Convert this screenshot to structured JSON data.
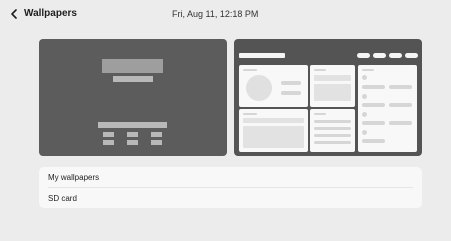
{
  "header": {
    "title": "Wallpapers",
    "datetime": "Fri, Aug 11, 12:18 PM",
    "back_icon": "chevron-left-icon"
  },
  "previews": {
    "lock_screen_label": "lock-screen-preview",
    "home_screen_label": "home-screen-preview"
  },
  "menu": {
    "items": [
      {
        "label": "My wallpapers"
      },
      {
        "label": "SD card"
      }
    ]
  },
  "colors": {
    "background": "#ececec",
    "preview_dark": "#5c5c5c",
    "card_light": "#f8f8f8"
  }
}
